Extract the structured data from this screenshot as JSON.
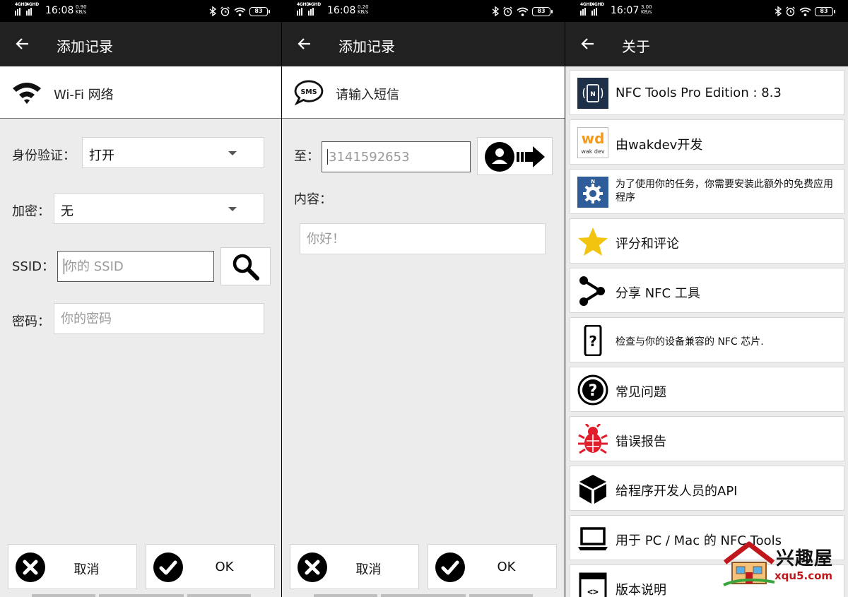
{
  "panels": [
    {
      "status": {
        "sig1": "4GHD",
        "sig2": "4GHD",
        "time": "16:08",
        "speed_val": "0.90",
        "speed_unit": "KB/s",
        "battery": "83"
      },
      "appbar": {
        "title": "添加记录"
      },
      "subheader": {
        "label": "Wi-Fi 网络",
        "icon": "wifi-icon"
      },
      "form": {
        "auth_label": "身份验证：",
        "auth_value": "打开",
        "enc_label": "加密：",
        "enc_value": "无",
        "ssid_label": "SSID：",
        "ssid_placeholder": "你的 SSID",
        "pwd_label": "密码：",
        "pwd_placeholder": "你的密码"
      },
      "buttons": {
        "cancel": "取消",
        "ok": "OK"
      }
    },
    {
      "status": {
        "sig1": "4GHD",
        "sig2": "4GHD",
        "time": "16:08",
        "speed_val": "0.20",
        "speed_unit": "KB/s",
        "battery": "83"
      },
      "appbar": {
        "title": "添加记录"
      },
      "subheader": {
        "label": "请输入短信",
        "icon": "sms-icon",
        "icon_text": "SMS"
      },
      "form": {
        "to_label": "至：",
        "to_placeholder": "3141592653",
        "content_label": "内容：",
        "content_placeholder": "你好！"
      },
      "buttons": {
        "cancel": "取消",
        "ok": "OK"
      }
    },
    {
      "status": {
        "sig1": "4GHD",
        "sig2": "4GHD",
        "time": "16:07",
        "speed_val": "3.00",
        "speed_unit": "KB/s",
        "battery": "83"
      },
      "appbar": {
        "title": "关于"
      },
      "items": [
        {
          "label": "NFC Tools Pro Edition : 8.3",
          "icon": "nfc-app-icon"
        },
        {
          "label": "由wakdev开发",
          "icon": "wakdev-logo-icon",
          "logo_top": "wd",
          "logo_bottom": "wak dev"
        },
        {
          "label": "为了使用你的任务，你需要安装此额外的免费应用程序",
          "icon": "nfc-tasks-gear-icon"
        },
        {
          "label": "评分和评论",
          "icon": "star-icon"
        },
        {
          "label": "分享 NFC 工具",
          "icon": "share-icon"
        },
        {
          "label": "检查与你的设备兼容的 NFC 芯片.",
          "icon": "phone-question-icon"
        },
        {
          "label": "常见问题",
          "icon": "help-circle-icon"
        },
        {
          "label": "错误报告",
          "icon": "bug-icon"
        },
        {
          "label": "给程序开发人员的API",
          "icon": "cube-icon"
        },
        {
          "label": "用于 PC / Mac 的 NFC Tools",
          "icon": "laptop-icon"
        },
        {
          "label": "版本说明",
          "icon": "code-icon"
        }
      ]
    }
  ],
  "watermark": {
    "name": "兴趣屋",
    "url": "xqu5.com"
  }
}
